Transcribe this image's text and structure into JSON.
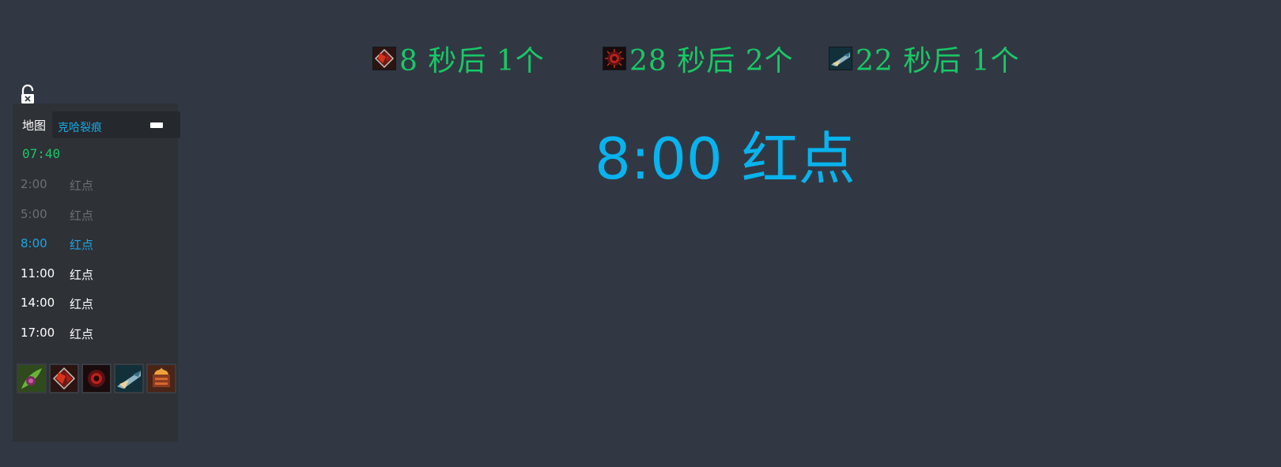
{
  "timers": [
    {
      "icon": "red-buff-icon",
      "text": "8 秒后 1个"
    },
    {
      "icon": "red-eye-icon",
      "text": "28 秒后 2个"
    },
    {
      "icon": "blue-jet-icon",
      "text": "22 秒后 1个"
    }
  ],
  "announcement": {
    "time": "8:00",
    "label": "红点"
  },
  "sidebar": {
    "lock_icon": "unlock-icon",
    "map_label": "地图",
    "map_value": "克哈裂痕",
    "clock": "07:40",
    "events": [
      {
        "time": "2:00",
        "label": "红点",
        "state": "past"
      },
      {
        "time": "5:00",
        "label": "红点",
        "state": "past"
      },
      {
        "time": "8:00",
        "label": "红点",
        "state": "current"
      },
      {
        "time": "11:00",
        "label": "红点",
        "state": "future"
      },
      {
        "time": "14:00",
        "label": "红点",
        "state": "future"
      },
      {
        "time": "17:00",
        "label": "红点",
        "state": "future"
      }
    ],
    "objective_icons": [
      "green-plant-icon",
      "red-buff-icon",
      "red-eye-icon",
      "blue-jet-icon",
      "fire-crate-icon"
    ]
  },
  "colors": {
    "background": "#313843",
    "timer_green": "#19c866",
    "accent_blue": "#08b3ee",
    "panel": "#2e3136"
  }
}
